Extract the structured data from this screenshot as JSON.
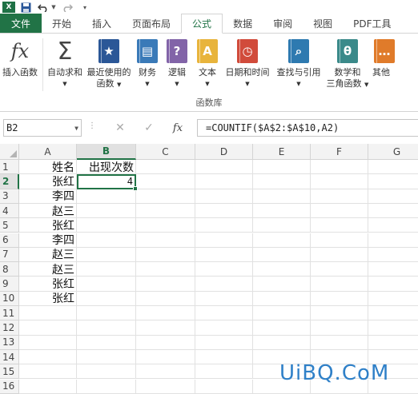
{
  "app": {
    "logo_letter": "X"
  },
  "tabs": [
    {
      "label": "文件"
    },
    {
      "label": "开始"
    },
    {
      "label": "插入"
    },
    {
      "label": "页面布局"
    },
    {
      "label": "公式"
    },
    {
      "label": "数据"
    },
    {
      "label": "审阅"
    },
    {
      "label": "视图"
    },
    {
      "label": "PDF工具"
    }
  ],
  "ribbon": {
    "items": [
      {
        "label": "插入函数",
        "icon": "fx-icon"
      },
      {
        "label": "自动求和",
        "icon": "sigma-icon",
        "dropdown": true
      },
      {
        "label": "最近使用的",
        "label2": "函数",
        "icon": "star-book-icon",
        "dropdown": true
      },
      {
        "label": "财务",
        "icon": "coins-book-icon",
        "dropdown": true
      },
      {
        "label": "逻辑",
        "icon": "question-book-icon",
        "dropdown": true
      },
      {
        "label": "文本",
        "icon": "a-book-icon",
        "dropdown": true
      },
      {
        "label": "日期和时间",
        "icon": "clock-book-icon",
        "dropdown": true
      },
      {
        "label": "查找与引用",
        "icon": "magnifier-book-icon",
        "dropdown": true
      },
      {
        "label": "数学和",
        "label2": "三角函数",
        "icon": "theta-book-icon",
        "dropdown": true
      },
      {
        "label": "其他",
        "icon": "more-book-icon"
      }
    ],
    "group_label": "函数库"
  },
  "formula_bar": {
    "name_box": "B2",
    "fx_label": "fx",
    "formula": "=COUNTIF($A$2:$A$10,A2)"
  },
  "sheet": {
    "columns": [
      "A",
      "B",
      "C",
      "D",
      "E",
      "F",
      "G"
    ],
    "rows": [
      "1",
      "2",
      "3",
      "4",
      "5",
      "6",
      "7",
      "8",
      "9",
      "10",
      "11",
      "12",
      "13",
      "14",
      "15",
      "16"
    ],
    "cells": {
      "A1": "姓名",
      "B1": "出现次数",
      "A2": "张红",
      "B2": "4",
      "A3": "李四",
      "A4": "赵三",
      "A5": "张红",
      "A6": "李四",
      "A7": "赵三",
      "A8": "赵三",
      "A9": "张红",
      "A10": "张红"
    },
    "selected_cell": "B2"
  },
  "watermark": "UiBQ.CoM",
  "colors": {
    "accent": "#217346",
    "watermark": "#2f80c8"
  }
}
